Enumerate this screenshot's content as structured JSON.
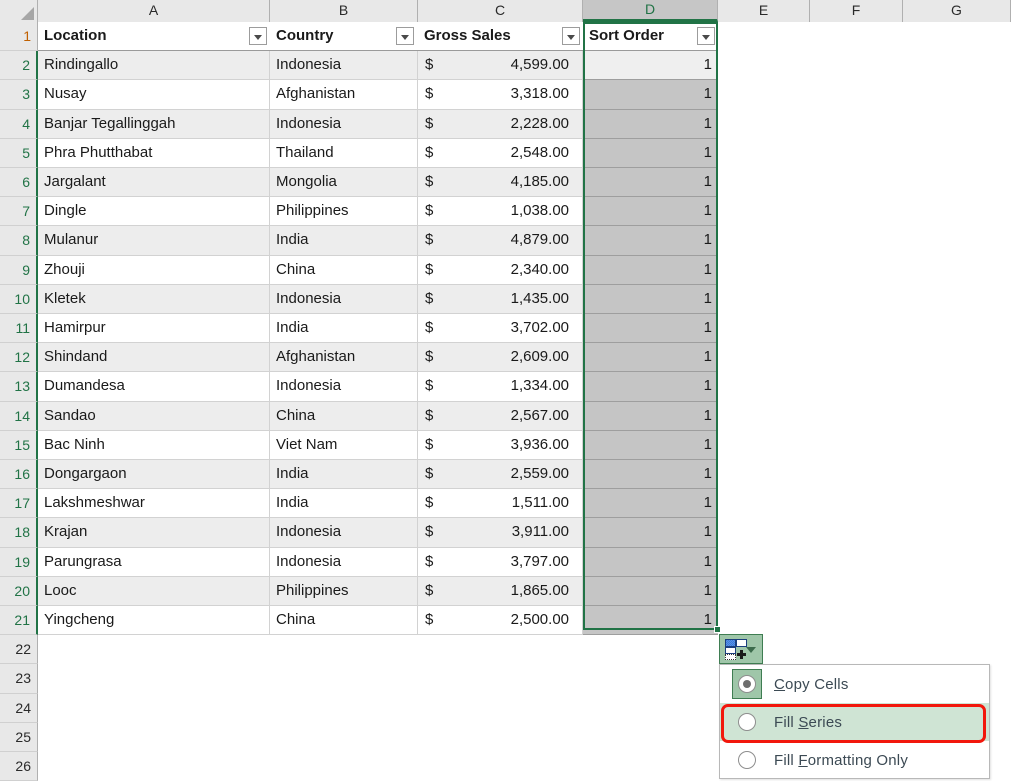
{
  "app": "excel-grid",
  "grid": {
    "column_headers": [
      "A",
      "B",
      "C",
      "D",
      "E",
      "F",
      "G"
    ],
    "selected_column": "D",
    "row_headers": [
      "1",
      "2",
      "3",
      "4",
      "5",
      "6",
      "7",
      "8",
      "9",
      "10",
      "11",
      "12",
      "13",
      "14",
      "15",
      "16",
      "17",
      "18",
      "19",
      "20",
      "21",
      "22",
      "23",
      "24",
      "25",
      "26"
    ],
    "table_headers": [
      "Location",
      "Country",
      "Gross Sales",
      "Sort Order"
    ],
    "currency_symbol": "$",
    "rows": [
      {
        "location": "Rindingallo",
        "country": "Indonesia",
        "gross_sales": "4,599.00",
        "sort_order": "1"
      },
      {
        "location": "Nusay",
        "country": "Afghanistan",
        "gross_sales": "3,318.00",
        "sort_order": "1"
      },
      {
        "location": "Banjar Tegallinggah",
        "country": "Indonesia",
        "gross_sales": "2,228.00",
        "sort_order": "1"
      },
      {
        "location": "Phra Phutthabat",
        "country": "Thailand",
        "gross_sales": "2,548.00",
        "sort_order": "1"
      },
      {
        "location": "Jargalant",
        "country": "Mongolia",
        "gross_sales": "4,185.00",
        "sort_order": "1"
      },
      {
        "location": "Dingle",
        "country": "Philippines",
        "gross_sales": "1,038.00",
        "sort_order": "1"
      },
      {
        "location": "Mulanur",
        "country": "India",
        "gross_sales": "4,879.00",
        "sort_order": "1"
      },
      {
        "location": "Zhouji",
        "country": "China",
        "gross_sales": "2,340.00",
        "sort_order": "1"
      },
      {
        "location": "Kletek",
        "country": "Indonesia",
        "gross_sales": "1,435.00",
        "sort_order": "1"
      },
      {
        "location": "Hamirpur",
        "country": "India",
        "gross_sales": "3,702.00",
        "sort_order": "1"
      },
      {
        "location": "Shindand",
        "country": "Afghanistan",
        "gross_sales": "2,609.00",
        "sort_order": "1"
      },
      {
        "location": "Dumandesa",
        "country": "Indonesia",
        "gross_sales": "1,334.00",
        "sort_order": "1"
      },
      {
        "location": "Sandao",
        "country": "China",
        "gross_sales": "2,567.00",
        "sort_order": "1"
      },
      {
        "location": "Bac Ninh",
        "country": "Viet Nam",
        "gross_sales": "3,936.00",
        "sort_order": "1"
      },
      {
        "location": "Dongargaon",
        "country": "India",
        "gross_sales": "2,559.00",
        "sort_order": "1"
      },
      {
        "location": "Lakshmeshwar",
        "country": "India",
        "gross_sales": "1,511.00",
        "sort_order": "1"
      },
      {
        "location": "Krajan",
        "country": "Indonesia",
        "gross_sales": "3,911.00",
        "sort_order": "1"
      },
      {
        "location": "Parungrasa",
        "country": "Indonesia",
        "gross_sales": "3,797.00",
        "sort_order": "1"
      },
      {
        "location": "Looc",
        "country": "Philippines",
        "gross_sales": "1,865.00",
        "sort_order": "1"
      },
      {
        "location": "Yingcheng",
        "country": "China",
        "gross_sales": "2,500.00",
        "sort_order": "1"
      }
    ]
  },
  "autofill": {
    "button_icon": "auto-fill-options-icon",
    "caret_icon": "chevron-down-icon",
    "menu_items": [
      {
        "label_pre": "",
        "label_key": "C",
        "label_post": "opy Cells",
        "checked": true,
        "highlighted": false
      },
      {
        "label_pre": "Fill ",
        "label_key": "S",
        "label_post": "eries",
        "checked": false,
        "highlighted": true
      },
      {
        "label_pre": "Fill ",
        "label_key": "F",
        "label_post": "ormatting Only",
        "checked": false,
        "highlighted": false
      }
    ]
  },
  "colors": {
    "accent_green": "#217346",
    "selection_fill": "#c5c5c5",
    "active_cell": "#efefef",
    "highlight_red": "#f2170c",
    "menu_highlight": "#cfe4d4"
  }
}
